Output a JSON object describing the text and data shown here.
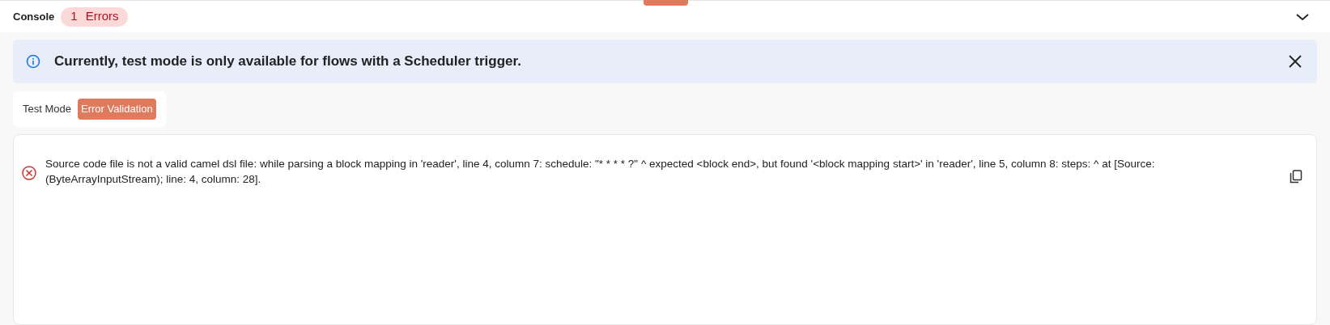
{
  "console": {
    "title": "Console",
    "error_count": "1",
    "error_label": "Errors",
    "expanded": true
  },
  "banner": {
    "message": "Currently, test mode is only available for flows with a Scheduler trigger."
  },
  "tabs": [
    {
      "label": "Test Mode",
      "selected": false
    },
    {
      "label": "Error Validation",
      "selected": true
    }
  ],
  "errors": [
    {
      "message": "Source code file is not a valid camel dsl file: while parsing a block mapping in 'reader', line 4, column 7: schedule: \"* * * * ?\" ^ expected <block end>, but found '<block mapping start>' in 'reader', line 5, column 8: steps: ^ at [Source: (ByteArrayInputStream); line: 4, column: 28]."
    }
  ]
}
